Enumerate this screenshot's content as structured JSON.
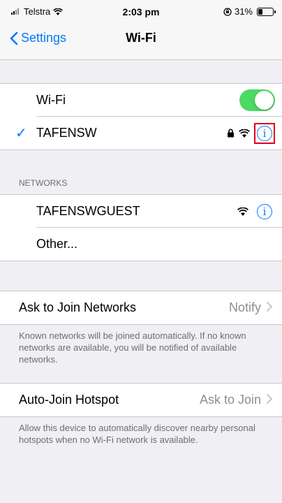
{
  "status_bar": {
    "carrier": "Telstra",
    "time": "2:03 pm",
    "battery_percent": "31%",
    "battery_level": 0.31
  },
  "nav": {
    "back_label": "Settings",
    "title": "Wi-Fi"
  },
  "wifi_toggle": {
    "label": "Wi-Fi",
    "on": true
  },
  "connected_network": {
    "name": "TAFENSW",
    "secured": true,
    "info_highlighted": true
  },
  "networks": {
    "header": "NETWORKS",
    "items": [
      {
        "name": "TAFENSWGUEST"
      },
      {
        "name": "Other..."
      }
    ]
  },
  "ask_to_join": {
    "label": "Ask to Join Networks",
    "value": "Notify",
    "footer": "Known networks will be joined automatically. If no known networks are available, you will be notified of available networks."
  },
  "auto_join_hotspot": {
    "label": "Auto-Join Hotspot",
    "value": "Ask to Join",
    "footer": "Allow this device to automatically discover nearby personal hotspots when no Wi-Fi network is available."
  },
  "colors": {
    "accent": "#007aff",
    "toggle_on": "#4cd964",
    "highlight": "#e0001b"
  }
}
